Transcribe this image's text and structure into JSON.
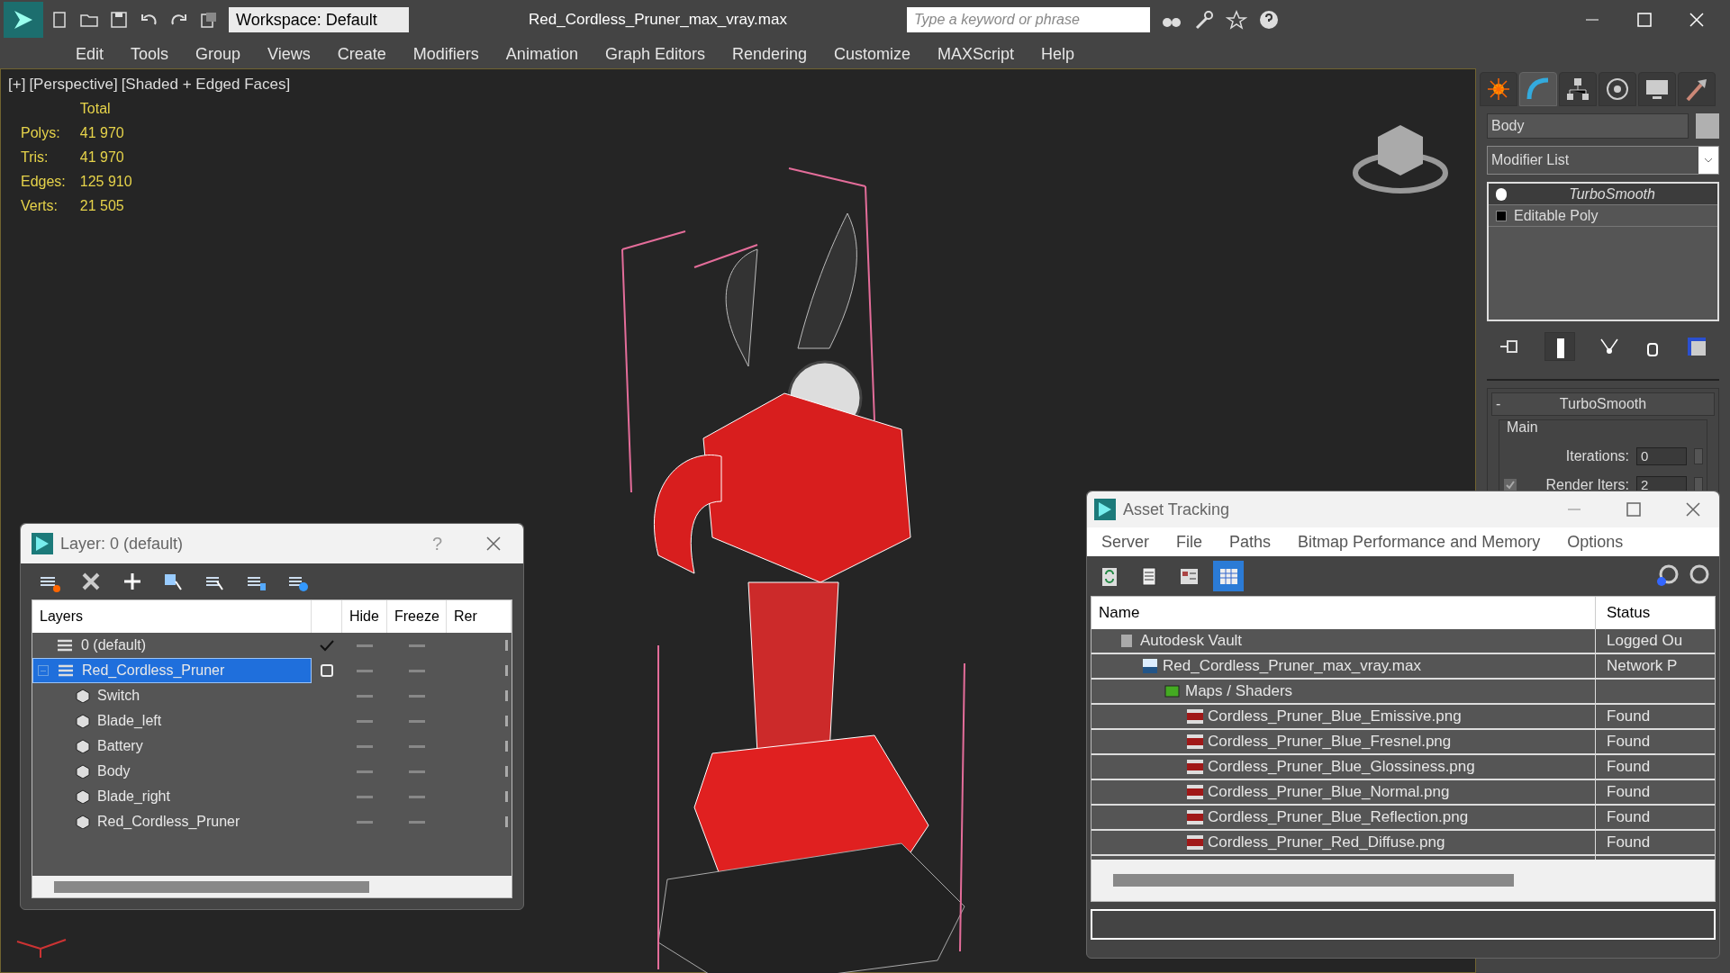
{
  "window": {
    "title": "Red_Cordless_Pruner_max_vray.max",
    "workspace": "Workspace: Default",
    "search_placeholder": "Type a keyword or phrase"
  },
  "menu": [
    "Edit",
    "Tools",
    "Group",
    "Views",
    "Create",
    "Modifiers",
    "Animation",
    "Graph Editors",
    "Rendering",
    "Customize",
    "MAXScript",
    "Help"
  ],
  "viewport": {
    "labels": [
      "[+]",
      "[Perspective]",
      "[Shaded + Edged Faces]"
    ],
    "stats": {
      "header": "Total",
      "rows": [
        {
          "label": "Polys:",
          "value": "41 970"
        },
        {
          "label": "Tris:",
          "value": "41 970"
        },
        {
          "label": "Edges:",
          "value": "125 910"
        },
        {
          "label": "Verts:",
          "value": "21 505"
        }
      ]
    }
  },
  "command_panel": {
    "tabs": [
      {
        "kind": "create",
        "selected": false
      },
      {
        "kind": "modify",
        "selected": true
      },
      {
        "kind": "hierarchy",
        "selected": false
      },
      {
        "kind": "motion",
        "selected": false
      },
      {
        "kind": "display",
        "selected": false
      },
      {
        "kind": "utilities",
        "selected": false
      }
    ],
    "object_name": "Body",
    "modifier_list": "Modifier List",
    "stack": [
      {
        "label": "TurboSmooth",
        "kind": "modifier",
        "selected": true
      },
      {
        "label": "Editable Poly",
        "kind": "base",
        "selected": false
      }
    ],
    "rollout": {
      "title": "TurboSmooth",
      "collapse": "-",
      "group": "Main",
      "fields": [
        {
          "label": "Iterations:",
          "value": "0"
        },
        {
          "label": "Render Iters:",
          "value": "2",
          "checked": true
        }
      ]
    }
  },
  "layer_dialog": {
    "title": "Layer: 0 (default)",
    "help": "?",
    "columns": [
      "Layers",
      "Hide",
      "Freeze",
      "Rer"
    ],
    "layers": [
      {
        "name": "0 (default)",
        "current": true,
        "selected": false,
        "expanded": false
      },
      {
        "name": "Red_Cordless_Pruner",
        "current": false,
        "selected": true,
        "expanded": true,
        "children": [
          {
            "name": "Switch"
          },
          {
            "name": "Blade_left"
          },
          {
            "name": "Battery"
          },
          {
            "name": "Body"
          },
          {
            "name": "Blade_right"
          },
          {
            "name": "Red_Cordless_Pruner"
          }
        ]
      }
    ]
  },
  "asset_tracking": {
    "title": "Asset Tracking",
    "menu": [
      "Server",
      "File",
      "Paths",
      "Bitmap Performance and Memory",
      "Options"
    ],
    "toolbar": [
      {
        "kind": "refresh",
        "selected": false
      },
      {
        "kind": "list",
        "selected": false
      },
      {
        "kind": "thumbnail",
        "selected": false
      },
      {
        "kind": "table",
        "selected": true
      }
    ],
    "columns": [
      "Name",
      "Status"
    ],
    "tree": [
      {
        "name": "Autodesk Vault",
        "kind": "vault",
        "status": "Logged Ou",
        "children": [
          {
            "name": "Red_Cordless_Pruner_max_vray.max",
            "kind": "max",
            "status": "Network P",
            "children": [
              {
                "name": "Maps / Shaders",
                "kind": "maps",
                "children": [
                  {
                    "name": "Cordless_Pruner_Blue_Emissive.png",
                    "kind": "png",
                    "status": "Found"
                  },
                  {
                    "name": "Cordless_Pruner_Blue_Fresnel.png",
                    "kind": "png",
                    "status": "Found"
                  },
                  {
                    "name": "Cordless_Pruner_Blue_Glossiness.png",
                    "kind": "png",
                    "status": "Found"
                  },
                  {
                    "name": "Cordless_Pruner_Blue_Normal.png",
                    "kind": "png",
                    "status": "Found"
                  },
                  {
                    "name": "Cordless_Pruner_Blue_Reflection.png",
                    "kind": "png",
                    "status": "Found"
                  },
                  {
                    "name": "Cordless_Pruner_Red_Diffuse.png",
                    "kind": "png",
                    "status": "Found"
                  }
                ]
              }
            ]
          }
        ]
      }
    ]
  }
}
